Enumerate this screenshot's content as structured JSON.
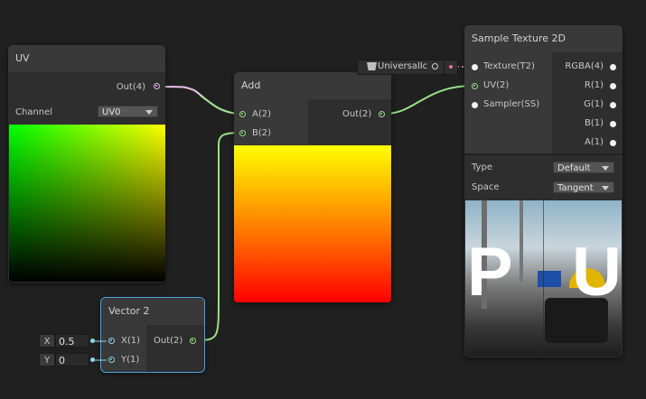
{
  "colors": {
    "uv_wire": "#e8c4e8",
    "vector_wire": "#9be08a",
    "selected_outline": "#4aa3e0",
    "texture_wire": "#e07a86"
  },
  "uv_node": {
    "title": "UV",
    "out_label": "Out(4)",
    "channel_label": "Channel",
    "channel_value": "UV0"
  },
  "add_node": {
    "title": "Add",
    "in_a": "A(2)",
    "in_b": "B(2)",
    "out_label": "Out(2)"
  },
  "vector2_node": {
    "title": "Vector 2",
    "x_label": "X(1)",
    "y_label": "Y(1)",
    "out_label": "Out(2)",
    "x_field_label": "X",
    "x_value": "0.5",
    "y_field_label": "Y",
    "y_value": "0"
  },
  "texture_input": {
    "label": "UniversalIc",
    "icon": "texture-icon"
  },
  "sample_node": {
    "title": "Sample Texture 2D",
    "inputs": [
      "Texture(T2)",
      "UV(2)",
      "Sampler(SS)"
    ],
    "outputs": [
      "RGBA(4)",
      "R(1)",
      "G(1)",
      "B(1)",
      "A(1)"
    ],
    "type_label": "Type",
    "type_value": "Default",
    "space_label": "Space",
    "space_value": "Tangent",
    "preview_letters": [
      "P",
      "U"
    ]
  }
}
